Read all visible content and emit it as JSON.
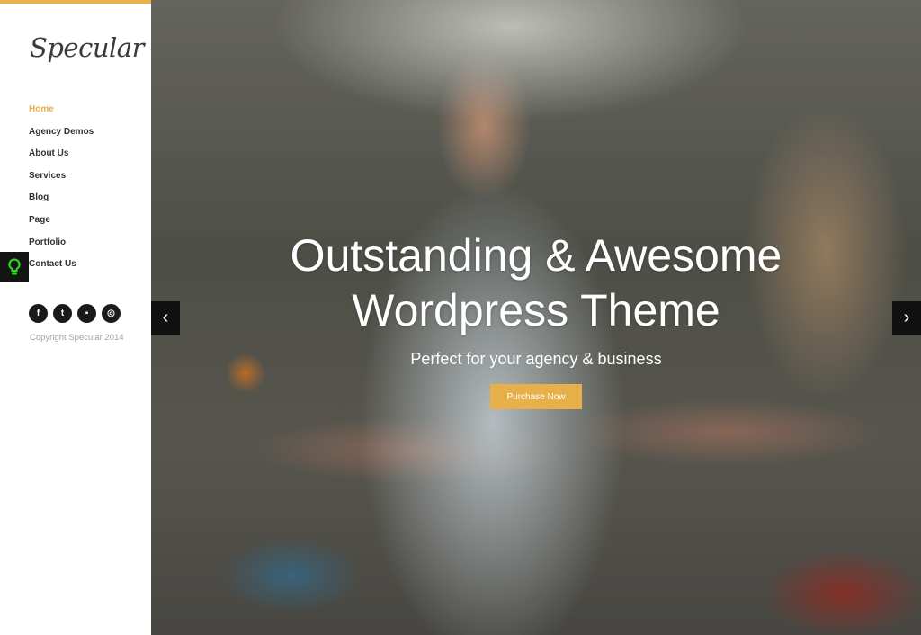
{
  "brand": {
    "logo": "Specular",
    "accent_color": "#e8b04a"
  },
  "sidebar": {
    "nav": [
      {
        "label": "Home",
        "active": true
      },
      {
        "label": "Agency Demos",
        "active": false
      },
      {
        "label": "About Us",
        "active": false
      },
      {
        "label": "Services",
        "active": false
      },
      {
        "label": "Blog",
        "active": false
      },
      {
        "label": "Page",
        "active": false
      },
      {
        "label": "Portfolio",
        "active": false
      },
      {
        "label": "Contact Us",
        "active": false
      }
    ],
    "social": [
      {
        "name": "facebook",
        "glyph": "f"
      },
      {
        "name": "twitter",
        "glyph": "t"
      },
      {
        "name": "flickr",
        "glyph": "▪"
      },
      {
        "name": "dribbble",
        "glyph": "◎"
      }
    ],
    "copyright": "Copyright Specular 2014"
  },
  "floating": {
    "bulb_icon": "lightbulb-icon",
    "bulb_color": "#22dd22"
  },
  "hero": {
    "title_line1": "Outstanding & Awesome",
    "title_line2": "Wordpress Theme",
    "subtitle": "Perfect for your agency & business",
    "cta_label": "Purchase Now",
    "prev_glyph": "‹",
    "next_glyph": "›"
  }
}
